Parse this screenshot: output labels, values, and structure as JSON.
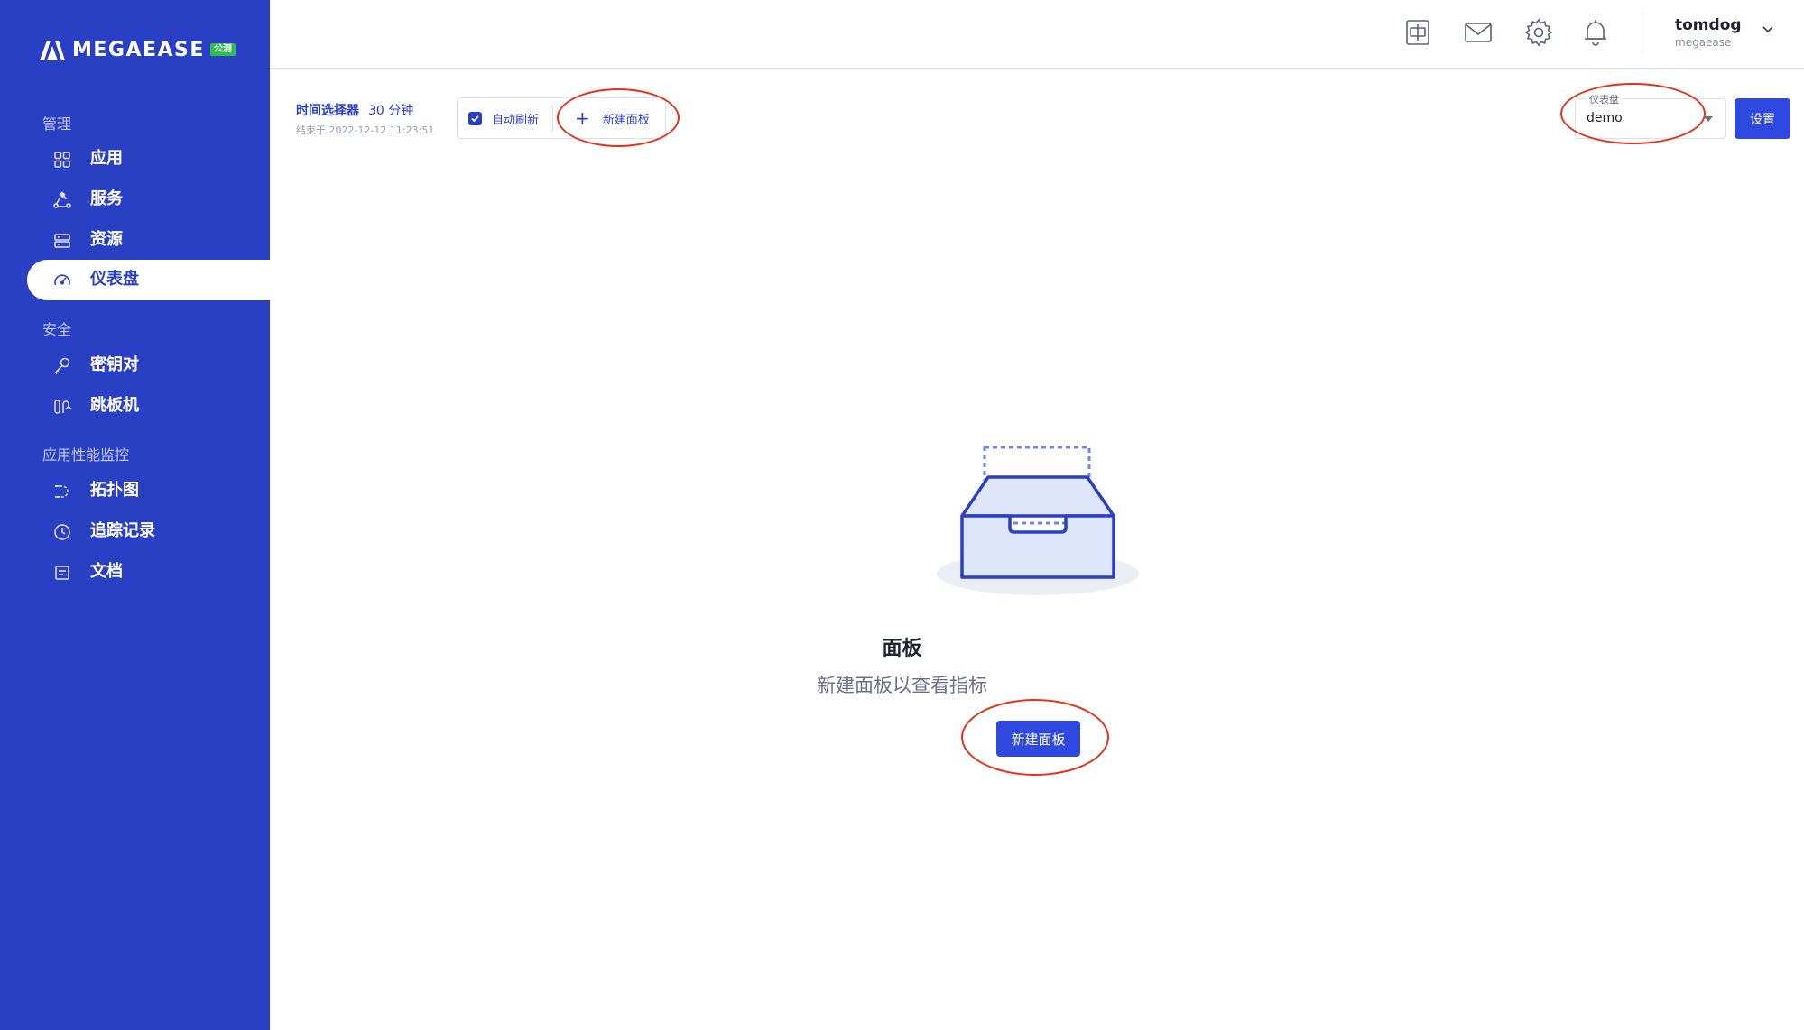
{
  "app": {
    "brand": "MEGAEASE",
    "brand_badge": "公测"
  },
  "sidebar": {
    "groups": [
      {
        "title": "管理",
        "items": [
          {
            "label": "应用",
            "icon": "grid-icon"
          },
          {
            "label": "服务",
            "icon": "recycle-icon"
          },
          {
            "label": "资源",
            "icon": "server-icon"
          },
          {
            "label": "仪表盘",
            "icon": "gauge-icon",
            "active": true
          }
        ]
      },
      {
        "title": "安全",
        "items": [
          {
            "label": "密钥对",
            "icon": "key-icon"
          },
          {
            "label": "跳板机",
            "icon": "jump-icon"
          }
        ]
      },
      {
        "title": "应用性能监控",
        "items": [
          {
            "label": "拓扑图",
            "icon": "topology-icon"
          },
          {
            "label": "追踪记录",
            "icon": "clock-icon"
          },
          {
            "label": "文档",
            "icon": "document-icon"
          }
        ]
      }
    ]
  },
  "header": {
    "user_name": "tomdog",
    "user_org": "megaease",
    "icons": [
      "language-icon",
      "mail-icon",
      "gear-icon",
      "bell-icon",
      "chevron-down-icon"
    ]
  },
  "toolbar": {
    "time_picker_label": "时间选择器",
    "time_picker_value": "30 分钟",
    "time_picker_end": "结束于 2022-12-12 11:23:51",
    "auto_refresh_label": "自动刷新",
    "auto_refresh_checked": true,
    "new_panel_label": "新建面板",
    "dashboard_select_label": "仪表盘",
    "dashboard_select_value": "demo",
    "settings_label": "设置"
  },
  "empty_state": {
    "title": "面板",
    "description": "新建面板以查看指标",
    "button_label": "新建面板"
  },
  "colors": {
    "sidebar_bg": "#2a40c4",
    "primary": "#2f48e0",
    "annotation": "#e2321c",
    "badge": "#2fbf4a"
  }
}
